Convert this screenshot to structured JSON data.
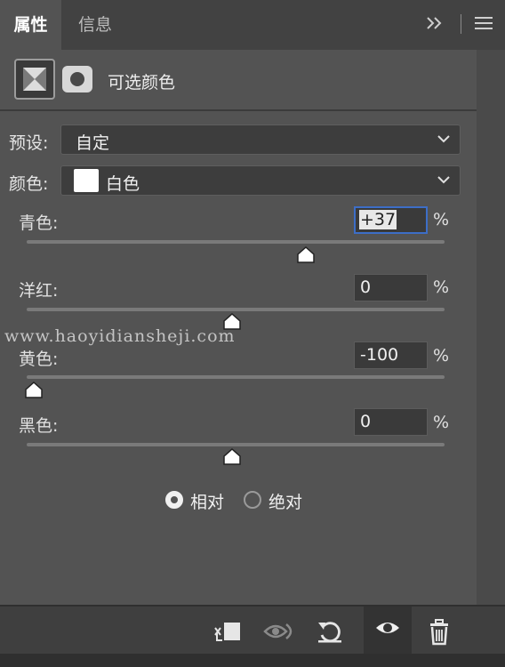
{
  "tabs": [
    {
      "label": "属性",
      "active": true
    },
    {
      "label": "信息",
      "active": false
    }
  ],
  "header": {
    "adjustment_title": "可选颜色",
    "icons": [
      "selective-color-icon",
      "layer-mask-icon"
    ]
  },
  "preset": {
    "label": "预设:",
    "value": "自定"
  },
  "color": {
    "label": "颜色:",
    "value": "白色",
    "swatch": "#ffffff"
  },
  "sliders": [
    {
      "label": "青色:",
      "value": "+37",
      "unit": "%",
      "position": 37,
      "focused": true
    },
    {
      "label": "洋红:",
      "value": "0",
      "unit": "%",
      "position": 0,
      "focused": false
    },
    {
      "label": "黄色:",
      "value": "-100",
      "unit": "%",
      "position": -100,
      "focused": false
    },
    {
      "label": "黑色:",
      "value": "0",
      "unit": "%",
      "position": 0,
      "focused": false
    }
  ],
  "slider_range": [
    -100,
    100
  ],
  "method": {
    "options": [
      {
        "label": "相对",
        "selected": true
      },
      {
        "label": "绝对",
        "selected": false
      }
    ]
  },
  "watermark": "www.haoyidiansheji.com",
  "footer_icons": [
    "clip-to-layer-icon",
    "view-previous-icon",
    "reset-icon",
    "visibility-icon",
    "delete-icon"
  ],
  "colors": {
    "panel": "#535353",
    "accent_focus": "#3d6ec7"
  }
}
